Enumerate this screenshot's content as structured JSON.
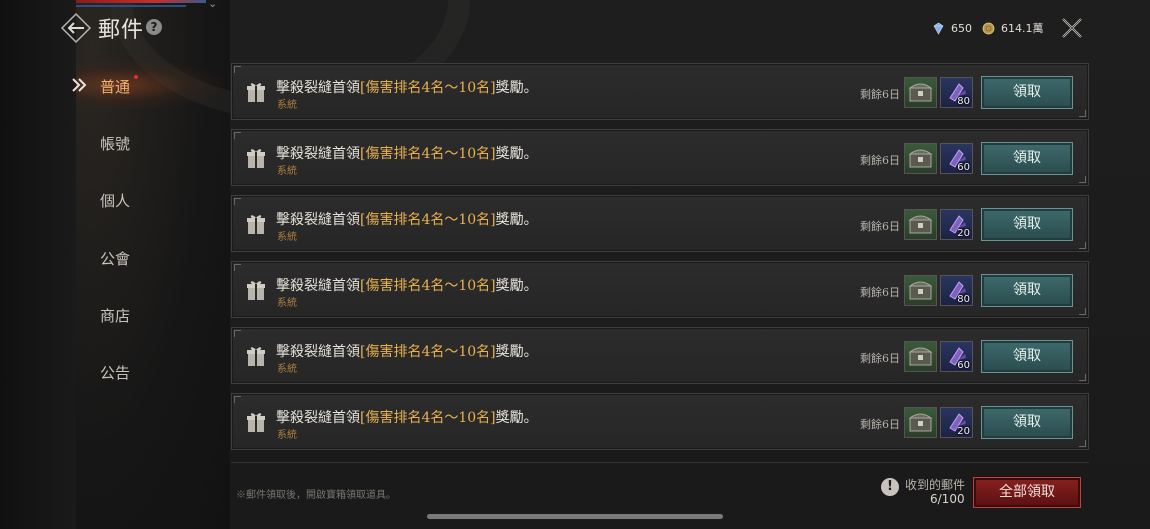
{
  "header": {
    "title": "郵件",
    "help_icon": "question-icon",
    "back_icon": "back-arrow-icon",
    "close_icon": "close-icon"
  },
  "currency": {
    "diamond": {
      "icon": "diamond-icon",
      "value": "650"
    },
    "gold": {
      "icon": "gold-coin-icon",
      "value": "614.1萬"
    }
  },
  "sidebar": {
    "items": [
      {
        "label": "普通",
        "active": true,
        "badge": true
      },
      {
        "label": "帳號",
        "active": false
      },
      {
        "label": "個人",
        "active": false
      },
      {
        "label": "公會",
        "active": false
      },
      {
        "label": "商店",
        "active": false
      },
      {
        "label": "公告",
        "active": false
      }
    ]
  },
  "mails": [
    {
      "title_pre": "擊殺裂縫首領",
      "title_hl": "[傷害排名4名～10名]",
      "title_post": "獎勵。",
      "sender": "系統",
      "remaining": "剩餘6日",
      "reward_qty": "80",
      "claim_label": "領取"
    },
    {
      "title_pre": "擊殺裂縫首領",
      "title_hl": "[傷害排名4名～10名]",
      "title_post": "獎勵。",
      "sender": "系統",
      "remaining": "剩餘6日",
      "reward_qty": "60",
      "claim_label": "領取"
    },
    {
      "title_pre": "擊殺裂縫首領",
      "title_hl": "[傷害排名4名～10名]",
      "title_post": "獎勵。",
      "sender": "系統",
      "remaining": "剩餘6日",
      "reward_qty": "20",
      "claim_label": "領取"
    },
    {
      "title_pre": "擊殺裂縫首領",
      "title_hl": "[傷害排名4名～10名]",
      "title_post": "獎勵。",
      "sender": "系統",
      "remaining": "剩餘6日",
      "reward_qty": "80",
      "claim_label": "領取"
    },
    {
      "title_pre": "擊殺裂縫首領",
      "title_hl": "[傷害排名4名～10名]",
      "title_post": "獎勵。",
      "sender": "系統",
      "remaining": "剩餘6日",
      "reward_qty": "60",
      "claim_label": "領取"
    },
    {
      "title_pre": "擊殺裂縫首領",
      "title_hl": "[傷害排名4名～10名]",
      "title_post": "獎勵。",
      "sender": "系統",
      "remaining": "剩餘6日",
      "reward_qty": "20",
      "claim_label": "領取"
    }
  ],
  "footer": {
    "note": "※郵件領取後，開啟寶箱領取道具。",
    "received_label": "收到的郵件",
    "received_count": "6/100",
    "claim_all_label": "全部領取"
  },
  "colors": {
    "highlight": "#e8b050",
    "claim_button": "#3e6a6c",
    "claim_all_button": "#8a2020",
    "sidebar_active": "#f0b070"
  }
}
